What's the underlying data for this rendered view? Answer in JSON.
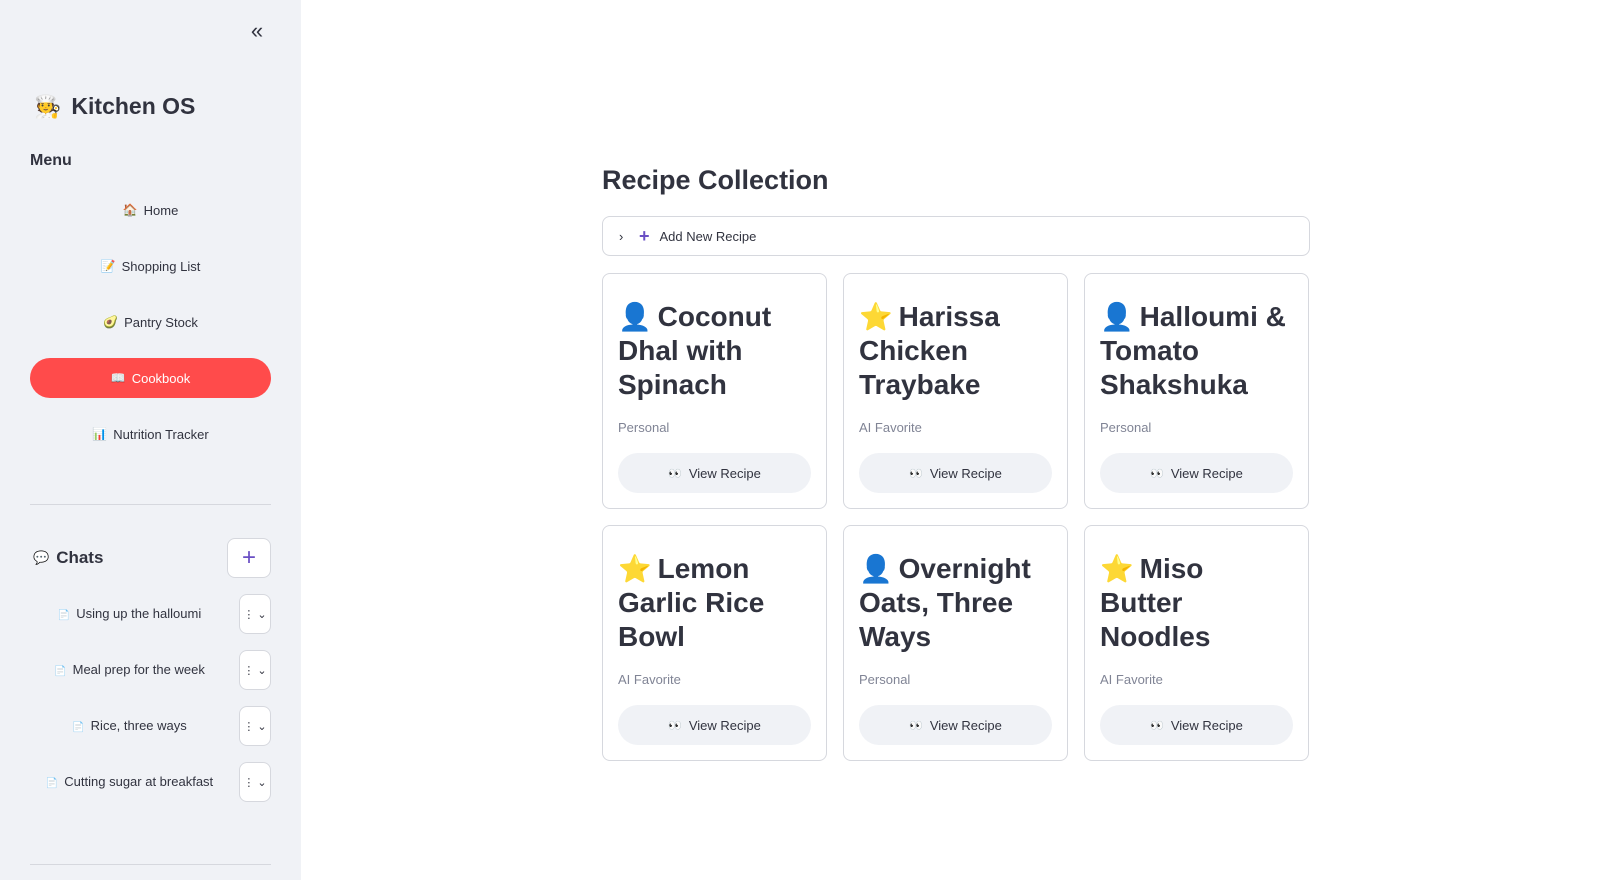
{
  "sidebar": {
    "collapse_icon": "«",
    "brand": {
      "emoji": "🧑‍🍳",
      "title": "Kitchen OS"
    },
    "menu_title": "Menu",
    "nav": [
      {
        "icon": "🏠",
        "label": "Home",
        "active": false
      },
      {
        "icon": "📝",
        "label": "Shopping List",
        "active": false
      },
      {
        "icon": "🥑",
        "label": "Pantry Stock",
        "active": false
      },
      {
        "icon": "📖",
        "label": "Cookbook",
        "active": true
      },
      {
        "icon": "📊",
        "label": "Nutrition Tracker",
        "active": false
      }
    ],
    "chats": {
      "icon": "💬",
      "title": "Chats",
      "new_icon": "+",
      "items": [
        {
          "icon": "📄",
          "label": "Using up the halloumi"
        },
        {
          "icon": "📄",
          "label": "Meal prep for the week"
        },
        {
          "icon": "📄",
          "label": "Rice, three ways"
        },
        {
          "icon": "📄",
          "label": "Cutting sugar at breakfast"
        }
      ],
      "menu_glyph": "⋮ ⌄"
    }
  },
  "main": {
    "title": "Recipe Collection",
    "add_recipe": {
      "chevron": "›",
      "plus": "+",
      "label": "Add New Recipe"
    },
    "recipes": [
      {
        "badge": "👤",
        "title": "Coconut Dhal with Spinach",
        "tag": "Personal",
        "button": "View Recipe"
      },
      {
        "badge": "⭐",
        "title": "Harissa Chicken Traybake",
        "tag": "AI Favorite",
        "button": "View Recipe"
      },
      {
        "badge": "👤",
        "title": "Halloumi & Tomato Shakshuka",
        "tag": "Personal",
        "button": "View Recipe"
      },
      {
        "badge": "⭐",
        "title": "Lemon Garlic Rice Bowl",
        "tag": "AI Favorite",
        "button": "View Recipe"
      },
      {
        "badge": "👤",
        "title": "Overnight Oats, Three Ways",
        "tag": "Personal",
        "button": "View Recipe"
      },
      {
        "badge": "⭐",
        "title": "Miso Butter Noodles",
        "tag": "AI Favorite",
        "button": "View Recipe"
      }
    ],
    "view_icon": "👀"
  },
  "colors": {
    "sidebar_bg": "#f0f2f6",
    "accent": "#ff4b4b",
    "plus_accent": "#6a4fc4",
    "border": "#d6d8de",
    "text": "#31333f",
    "muted": "#808495"
  }
}
